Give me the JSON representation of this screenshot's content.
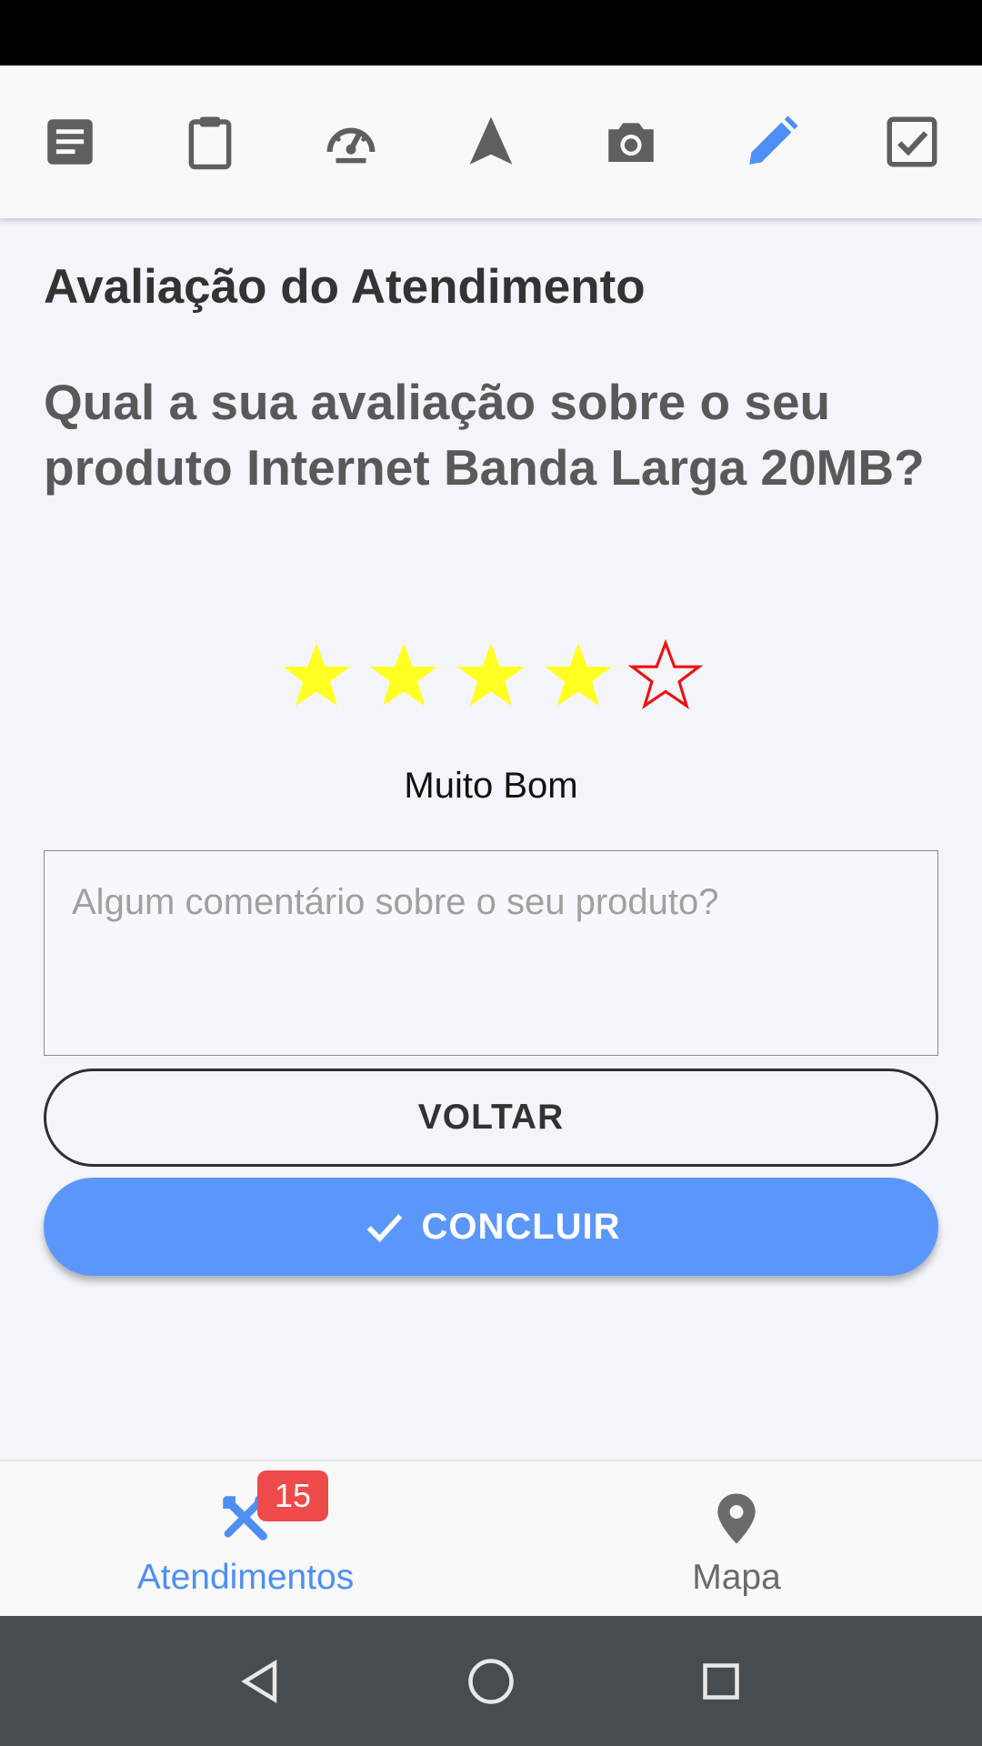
{
  "toolbar": {
    "icons": [
      "document-icon",
      "clipboard-icon",
      "speedometer-icon",
      "navigation-icon",
      "camera-icon",
      "pencil-icon",
      "checkbox-icon"
    ],
    "active": "pencil-icon",
    "active_color": "#4e8ff5",
    "inactive_color": "#5f5f5f"
  },
  "page": {
    "title": "Avaliação do Atendimento",
    "question": "Qual a sua avaliação sobre o seu produto Internet Banda Larga 20MB?"
  },
  "rating": {
    "value": 4,
    "max": 5,
    "label": "Muito Bom",
    "filled_color": "#ffff22",
    "empty_color": "#ee1111"
  },
  "comment": {
    "placeholder": "Algum comentário sobre o seu produto?",
    "value": ""
  },
  "buttons": {
    "back_label": "VOLTAR",
    "done_label": "CONCLUIR",
    "done_color": "#5b97fb"
  },
  "bottom_nav": {
    "items": [
      {
        "label": "Atendimentos",
        "icon": "tools-icon",
        "badge": "15",
        "active": true
      },
      {
        "label": "Mapa",
        "icon": "map-pin-icon",
        "active": false
      }
    ]
  },
  "system_nav": [
    "back-triangle-icon",
    "home-circle-icon",
    "recents-square-icon"
  ]
}
